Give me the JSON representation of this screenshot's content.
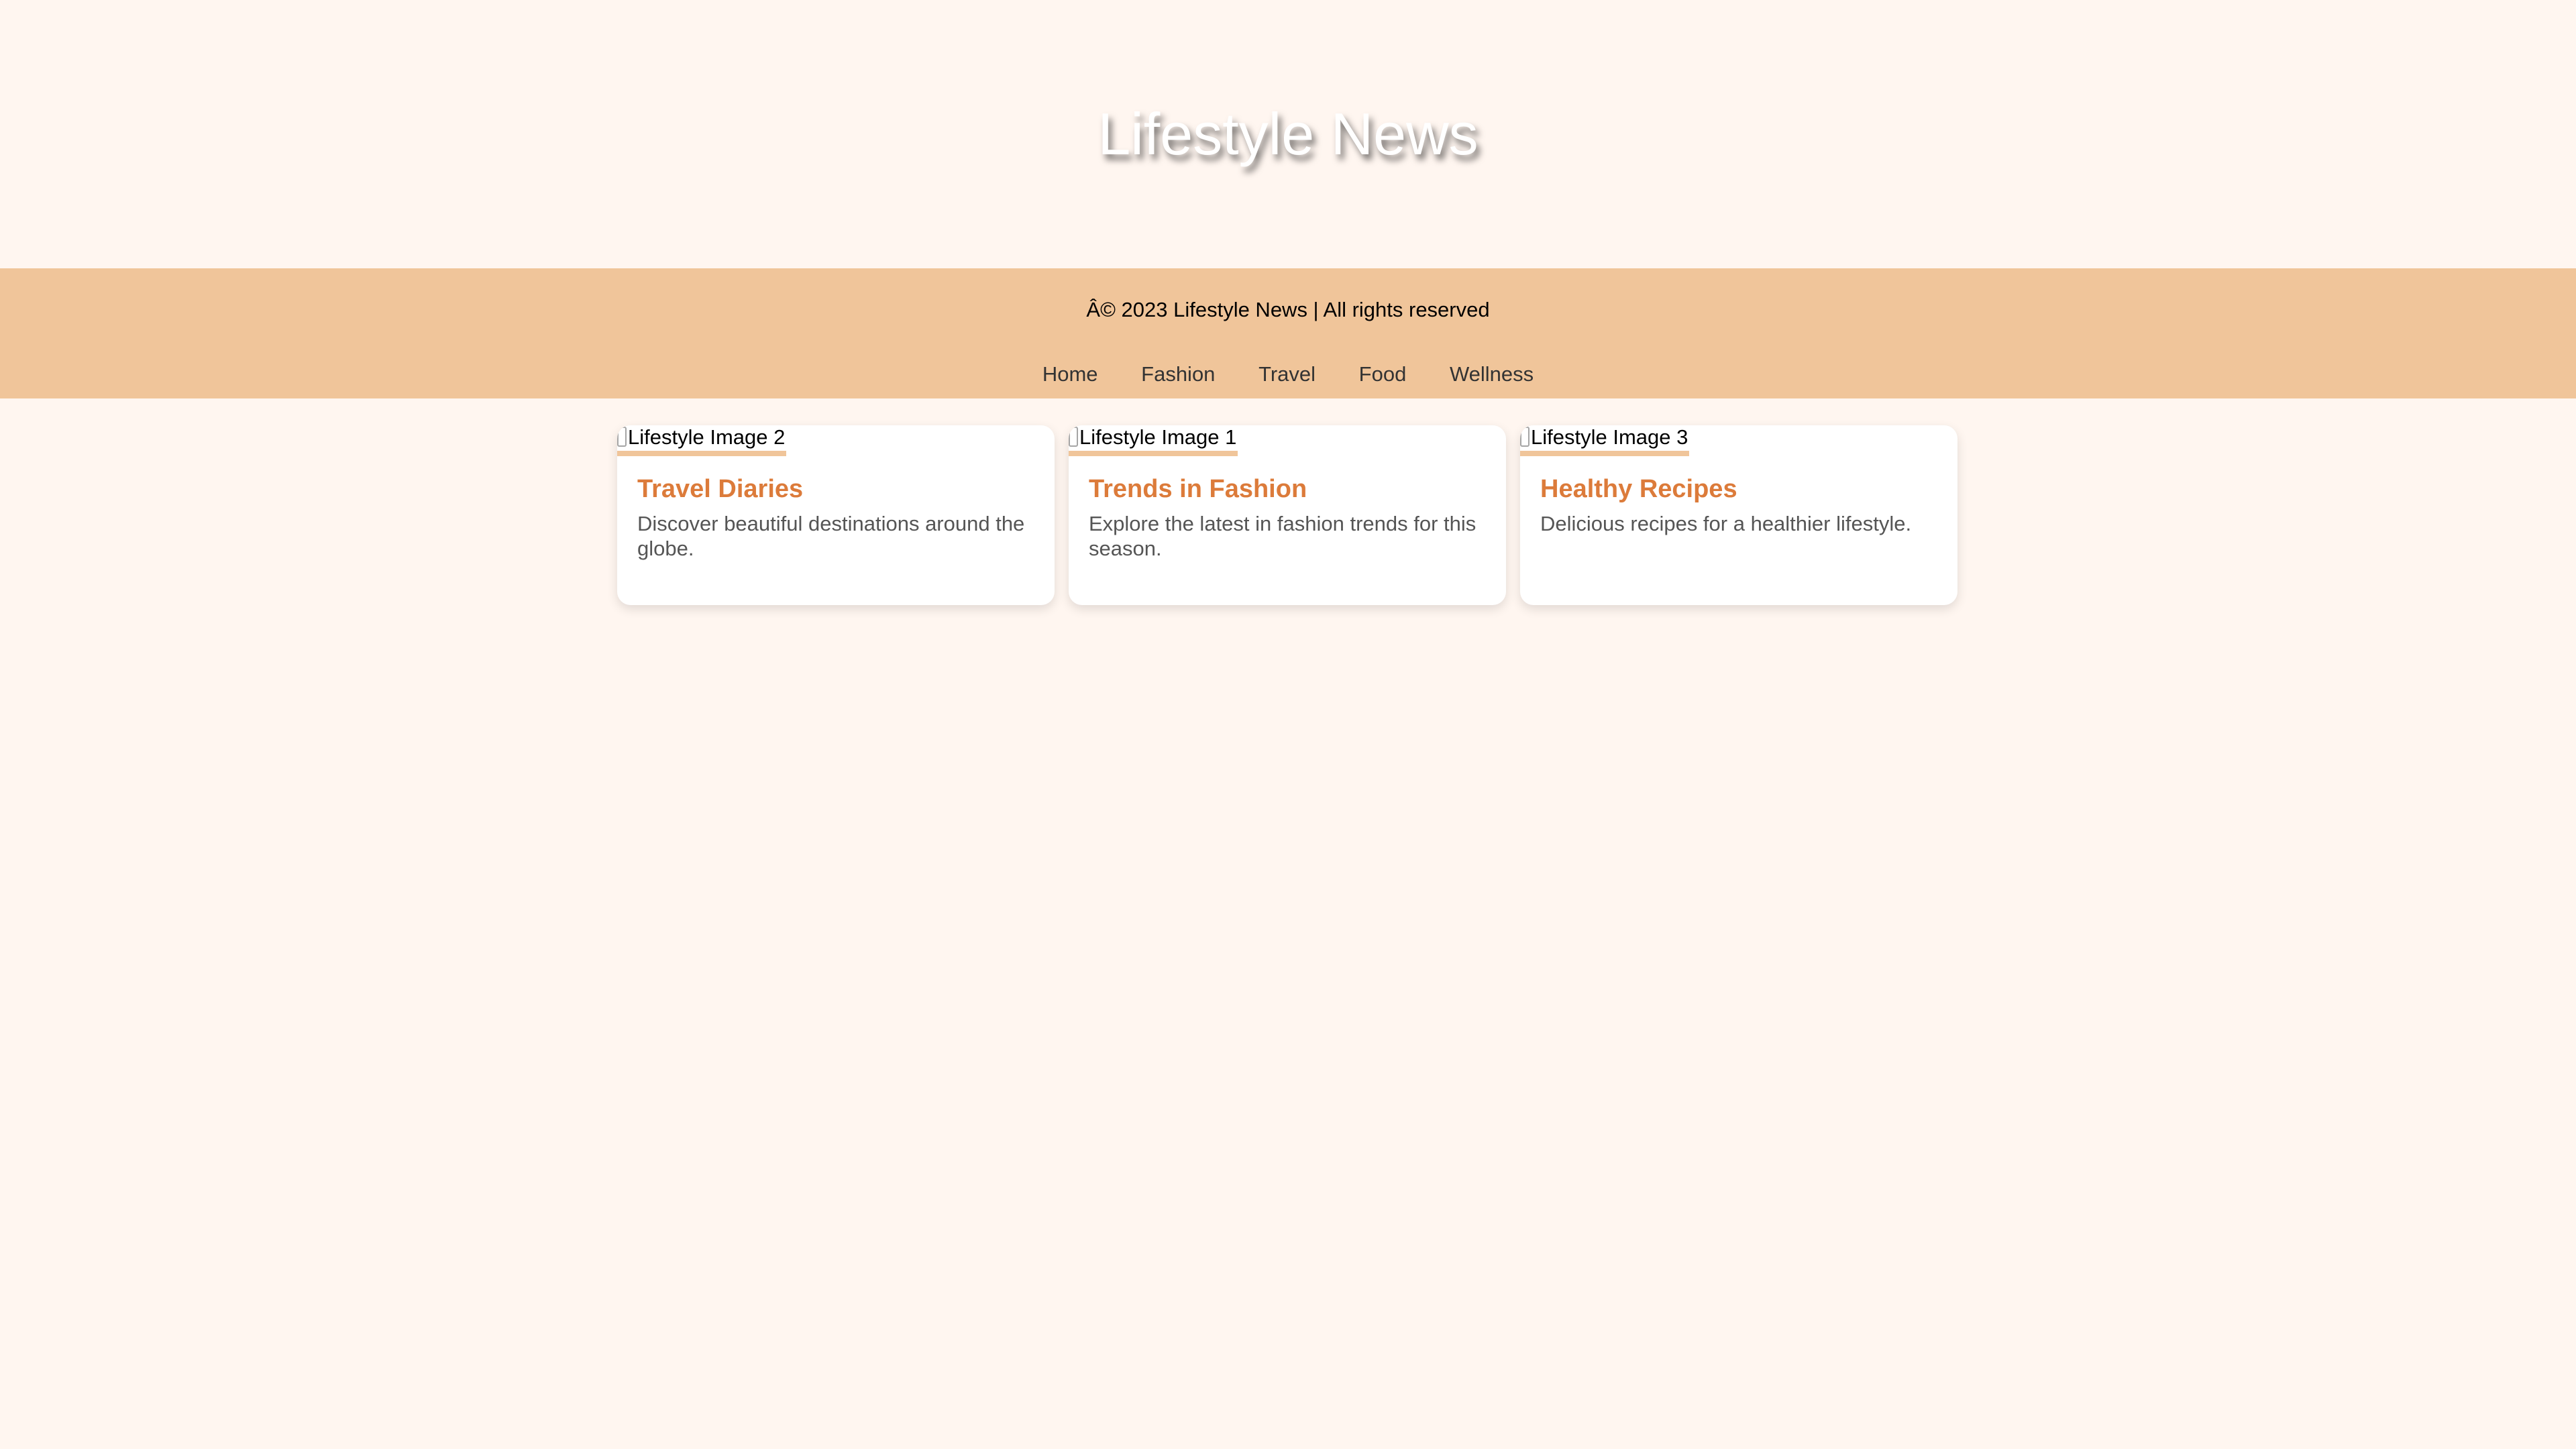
{
  "header": {
    "title": "Lifestyle News"
  },
  "band": {
    "copyright": "Â© 2023 Lifestyle News | All rights reserved",
    "nav": [
      "Home",
      "Fashion",
      "Travel",
      "Food",
      "Wellness"
    ]
  },
  "cards": [
    {
      "image_alt": "Lifestyle Image 2",
      "title": "Travel Diaries",
      "description": "Discover beautiful destinations around the globe."
    },
    {
      "image_alt": "Lifestyle Image 1",
      "title": "Trends in Fashion",
      "description": "Explore the latest in fashion trends for this season."
    },
    {
      "image_alt": "Lifestyle Image 3",
      "title": "Healthy Recipes",
      "description": "Delicious recipes for a healthier lifestyle."
    }
  ],
  "colors": {
    "page_background": "#fff6f0",
    "band_background": "#f0c59a",
    "accent_title": "#dc7b3a",
    "card_background": "#ffffff"
  }
}
